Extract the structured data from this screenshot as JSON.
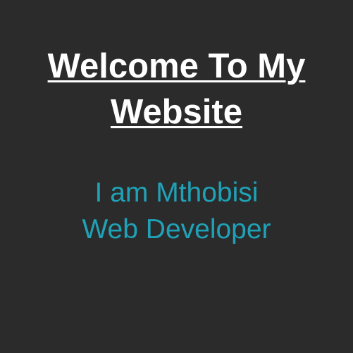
{
  "hero": {
    "title_line1": "Welcome To My",
    "title_line2": "Website"
  },
  "intro": {
    "line1": "I am Mthobisi",
    "line2": "Web Developer"
  },
  "colors": {
    "background": "#2b2b2b",
    "title": "#ffffff",
    "accent": "#1fa2b7"
  }
}
